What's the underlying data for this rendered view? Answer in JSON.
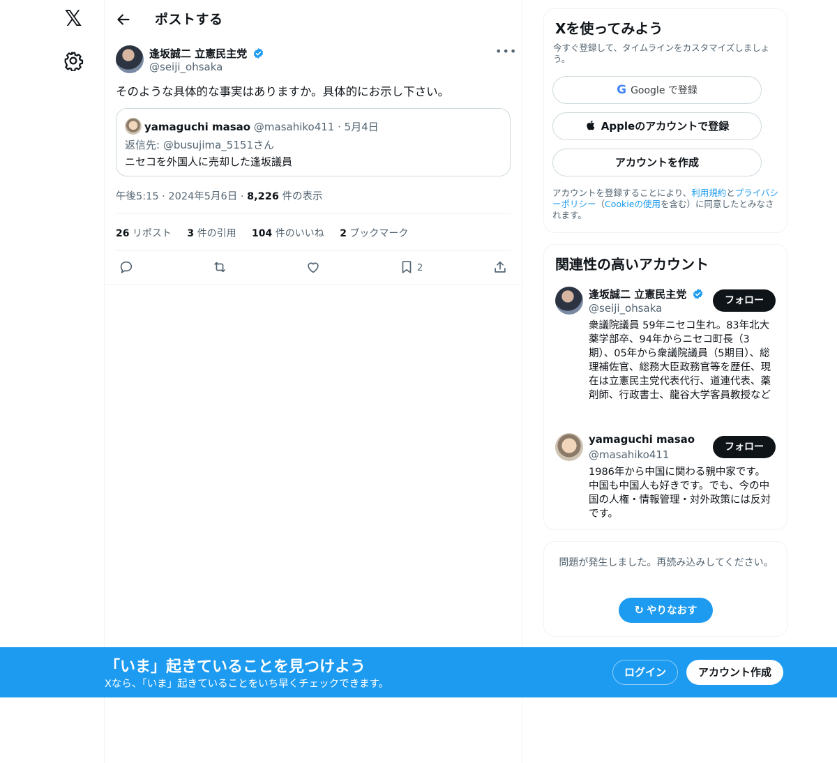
{
  "nav": {
    "logo": "𝕏",
    "logo_icon": "x-logo",
    "settings_icon": "gear-icon"
  },
  "header": {
    "title": "ポストする",
    "back_icon": "arrow-left-icon"
  },
  "post": {
    "author_name": "逢坂誠二 立憲民主党",
    "author_handle": "@seiji_ohsaka",
    "more_label": "•••",
    "text": "そのような具体的な事実はありますか。具体的にお示し下さい。",
    "quote": {
      "name": "yamaguchi masao",
      "handle": "@masahiko411",
      "sep": " · ",
      "date": "5月4日",
      "reply_to": "返信先: @busujima_5151さん",
      "text": "ニセコを外国人に売却した逢坂議員"
    },
    "meta": {
      "time": "午後5:15",
      "date": "2024年5月6日",
      "views_count": "8,226",
      "views_label": " 件の表示",
      "sep": " · "
    },
    "stats": [
      {
        "count": "26",
        "label": " リポスト"
      },
      {
        "count": "3",
        "label": " 件の引用"
      },
      {
        "count": "104",
        "label": " 件のいいね"
      },
      {
        "count": "2",
        "label": " ブックマーク"
      }
    ],
    "actions": {
      "bookmark_count": "2"
    }
  },
  "signup": {
    "title": "Xを使ってみよう",
    "subtitle": "今すぐ登録して、タイムラインをカスタマイズしましょう。",
    "google_g": "G",
    "google_label": "Google で登録",
    "apple_label": "Appleのアカウントで登録",
    "create_label": "アカウントを作成",
    "terms_1": "アカウントを登録することにより、",
    "terms_link1": "利用規約",
    "terms_2": "と",
    "terms_link2": "プライバシーポリシー",
    "terms_3": "（",
    "terms_link3": "Cookieの使用",
    "terms_4": "を含む）に同意したとみなされます。"
  },
  "related": {
    "title": "関連性の高いアカウント",
    "accounts": [
      {
        "name": "逢坂誠二 立憲民主党",
        "handle": "@seiji_ohsaka",
        "bio": "衆議院議員 59年ニセコ生れ。83年北大薬学部卒、94年からニセコ町長（3期）、05年から衆議院議員（5期目）、総理補佐官、総務大臣政務官等を歴任、現在は立憲民主党代表代行、道連代表、薬剤師、行政書士、龍谷大学客員教授など",
        "follow_label": "フォロー"
      },
      {
        "name": "yamaguchi masao",
        "handle": "@masahiko411",
        "bio": "1986年から中国に関わる親中家です。中国も中国人も好きです。でも、今の中国の人権・情報管理・対外政策には反対です。",
        "follow_label": "フォロー"
      }
    ]
  },
  "error": {
    "text": "問題が発生しました。再読み込みしてください。",
    "retry_label": "やりなおす",
    "retry_icon": "↻"
  },
  "banner": {
    "title": "「いま」起きていることを見つけよう",
    "subtitle": "Xなら、「いま」起きていることをいち早くチェックできます。",
    "login_label": "ログイン",
    "create_label": "アカウント作成"
  },
  "colors": {
    "accent": "#1d9bf0",
    "text": "#0f1419",
    "muted": "#536471",
    "border": "#eff3f4"
  }
}
